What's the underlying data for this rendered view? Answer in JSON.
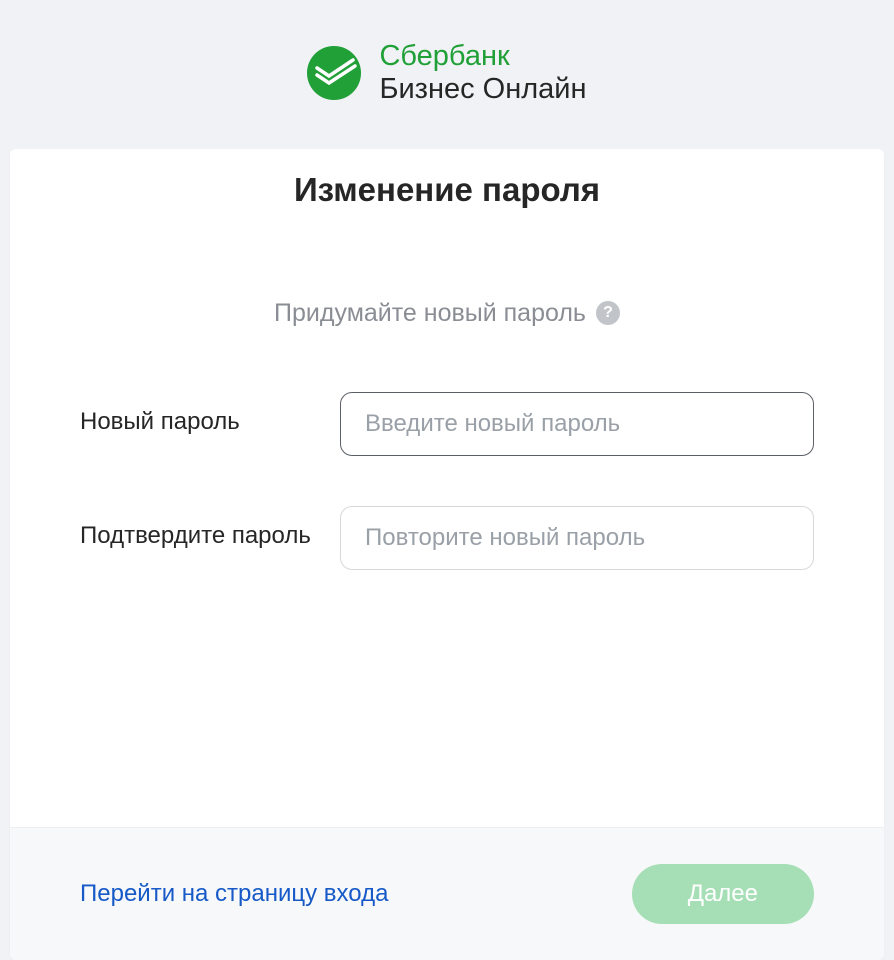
{
  "header": {
    "brand_line1": "Сбербанк",
    "brand_line2": "Бизнес Онлайн",
    "brand_color": "#21a038"
  },
  "card": {
    "title": "Изменение пароля",
    "subtitle": "Придумайте новый пароль"
  },
  "form": {
    "new_password_label": "Новый пароль",
    "new_password_placeholder": "Введите новый пароль",
    "confirm_password_label": "Подтвердите пароль",
    "confirm_password_placeholder": "Повторите новый пароль"
  },
  "footer": {
    "back_link": "Перейти на страницу входа",
    "next_button": "Далее"
  }
}
